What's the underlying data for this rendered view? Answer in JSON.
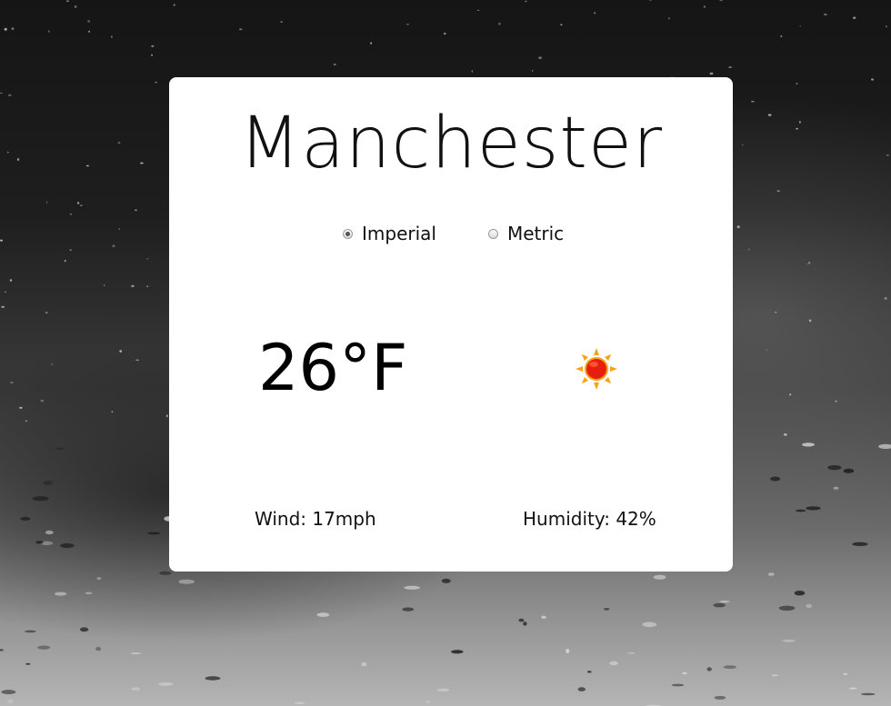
{
  "location": {
    "city": "Manchester"
  },
  "units": {
    "options": [
      {
        "label": "Imperial",
        "selected": true
      },
      {
        "label": "Metric",
        "selected": false
      }
    ]
  },
  "current": {
    "temperature": "26°F",
    "condition_icon": "sun-icon",
    "wind": "Wind: 17mph",
    "humidity": "Humidity: 42%"
  },
  "colors": {
    "card_background": "#ffffff",
    "sun_core": "#e81e0c",
    "sun_rays": "#f7a21a"
  }
}
